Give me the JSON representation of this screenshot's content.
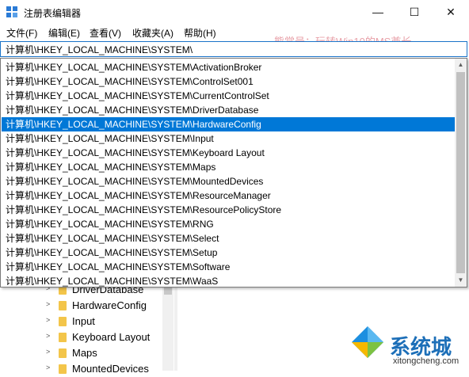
{
  "window": {
    "title": "注册表编辑器",
    "minimize_glyph": "—",
    "maximize_glyph": "☐",
    "close_glyph": "✕"
  },
  "menu": {
    "items": [
      {
        "label": "文件(F)"
      },
      {
        "label": "编辑(E)"
      },
      {
        "label": "查看(V)"
      },
      {
        "label": "收藏夹(A)"
      },
      {
        "label": "帮助(H)"
      }
    ]
  },
  "watermark_top": "熊掌号：玩转Win10的MS酋长",
  "address": {
    "value": "计算机\\HKEY_LOCAL_MACHINE\\SYSTEM\\"
  },
  "suggestions": {
    "items": [
      "计算机\\HKEY_LOCAL_MACHINE\\SYSTEM\\ActivationBroker",
      "计算机\\HKEY_LOCAL_MACHINE\\SYSTEM\\ControlSet001",
      "计算机\\HKEY_LOCAL_MACHINE\\SYSTEM\\CurrentControlSet",
      "计算机\\HKEY_LOCAL_MACHINE\\SYSTEM\\DriverDatabase",
      "计算机\\HKEY_LOCAL_MACHINE\\SYSTEM\\HardwareConfig",
      "计算机\\HKEY_LOCAL_MACHINE\\SYSTEM\\Input",
      "计算机\\HKEY_LOCAL_MACHINE\\SYSTEM\\Keyboard Layout",
      "计算机\\HKEY_LOCAL_MACHINE\\SYSTEM\\Maps",
      "计算机\\HKEY_LOCAL_MACHINE\\SYSTEM\\MountedDevices",
      "计算机\\HKEY_LOCAL_MACHINE\\SYSTEM\\ResourceManager",
      "计算机\\HKEY_LOCAL_MACHINE\\SYSTEM\\ResourcePolicyStore",
      "计算机\\HKEY_LOCAL_MACHINE\\SYSTEM\\RNG",
      "计算机\\HKEY_LOCAL_MACHINE\\SYSTEM\\Select",
      "计算机\\HKEY_LOCAL_MACHINE\\SYSTEM\\Setup",
      "计算机\\HKEY_LOCAL_MACHINE\\SYSTEM\\Software",
      "计算机\\HKEY_LOCAL_MACHINE\\SYSTEM\\WaaS"
    ],
    "selected_index": 4
  },
  "tree": {
    "items": [
      {
        "label": "DriverDatabase"
      },
      {
        "label": "HardwareConfig"
      },
      {
        "label": "Input"
      },
      {
        "label": "Keyboard Layout"
      },
      {
        "label": "Maps"
      },
      {
        "label": "MountedDevices"
      }
    ]
  },
  "watermark_bottom": {
    "brand": "系统城",
    "url": "xitongcheng.com"
  },
  "colors": {
    "selection": "#0078d7",
    "folder": "#f3c54a",
    "watermark_pink": "#e8a0a8",
    "watermark_blue": "#1d6fb8"
  }
}
